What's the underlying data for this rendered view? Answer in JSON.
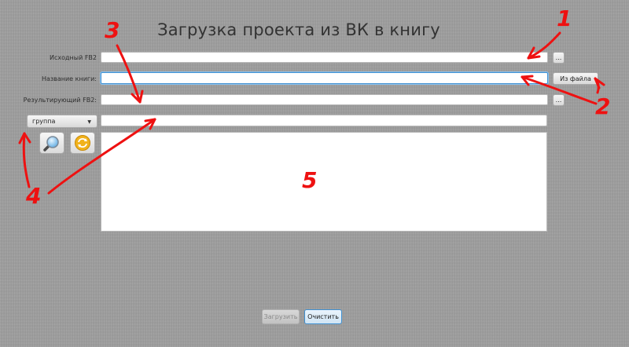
{
  "window": {
    "title": "Загрузка проекта из ВК в книгу"
  },
  "form": {
    "source_fb2": {
      "label": "Исходный FB2",
      "value": "",
      "browse_label": "..."
    },
    "book_name": {
      "label": "Название книги:",
      "value": "",
      "from_file_label": "Из файла"
    },
    "result_fb2": {
      "label": "Результирующий FB2:",
      "value": "",
      "browse_label": "..."
    },
    "source_type": {
      "selected": "группа"
    },
    "group_input": {
      "value": ""
    },
    "search_button": {
      "icon": "magnifier-icon"
    },
    "refresh_button": {
      "icon": "refresh-icon"
    }
  },
  "log_area": {
    "value": ""
  },
  "footer": {
    "load_label": "Загрузить",
    "load_enabled": false,
    "clear_label": "Очистить"
  },
  "annotations": {
    "n1": "1",
    "n2": "2",
    "n3": "3",
    "n4": "4",
    "n5": "5",
    "color": "#ee1111"
  }
}
